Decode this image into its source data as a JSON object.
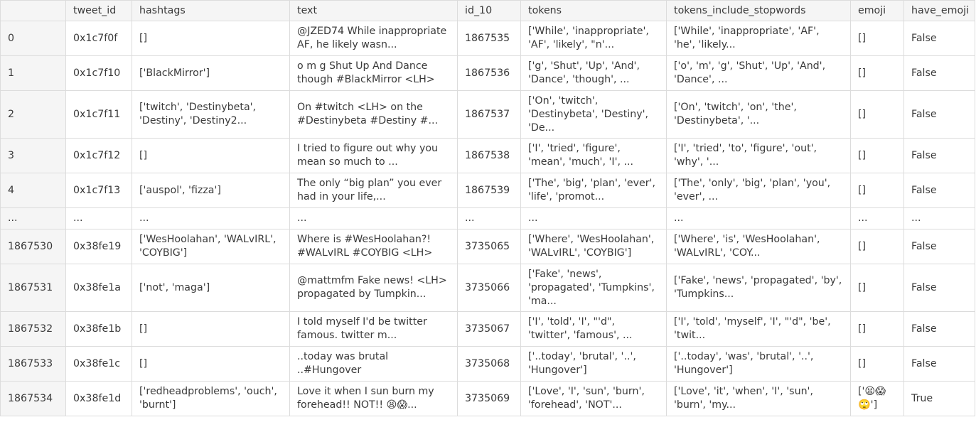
{
  "columns": [
    "",
    "tweet_id",
    "hashtags",
    "text",
    "id_10",
    "tokens",
    "tokens_include_stopwords",
    "emoji",
    "have_emoji"
  ],
  "rows": [
    {
      "index": "0",
      "tweet_id": "0x1c7f0f",
      "hashtags": "[]",
      "text": "@JZED74 While inappropriate AF, he likely wasn...",
      "id_10": "1867535",
      "tokens": "['While', 'inappropriate', 'AF', 'likely', \"n'...",
      "tokens_include_stopwords": "['While', 'inappropriate', 'AF', 'he', 'likely...",
      "emoji": "[]",
      "have_emoji": "False"
    },
    {
      "index": "1",
      "tweet_id": "0x1c7f10",
      "hashtags": "['BlackMirror']",
      "text": "o m g Shut Up And Dance though #BlackMirror <LH>",
      "id_10": "1867536",
      "tokens": "['g', 'Shut', 'Up', 'And', 'Dance', 'though', ...",
      "tokens_include_stopwords": "['o', 'm', 'g', 'Shut', 'Up', 'And', 'Dance', ...",
      "emoji": "[]",
      "have_emoji": "False"
    },
    {
      "index": "2",
      "tweet_id": "0x1c7f11",
      "hashtags": "['twitch', 'Destinybeta', 'Destiny', 'Destiny2...",
      "text": "On #twitch <LH> on the #Destinybeta #Destiny #...",
      "id_10": "1867537",
      "tokens": "['On', 'twitch', 'Destinybeta', 'Destiny', 'De...",
      "tokens_include_stopwords": "['On', 'twitch', 'on', 'the', 'Destinybeta', '...",
      "emoji": "[]",
      "have_emoji": "False"
    },
    {
      "index": "3",
      "tweet_id": "0x1c7f12",
      "hashtags": "[]",
      "text": "I tried to figure out why you mean so much to ...",
      "id_10": "1867538",
      "tokens": "['I', 'tried', 'figure', 'mean', 'much', 'I', ...",
      "tokens_include_stopwords": "['I', 'tried', 'to', 'figure', 'out', 'why', '...",
      "emoji": "[]",
      "have_emoji": "False"
    },
    {
      "index": "4",
      "tweet_id": "0x1c7f13",
      "hashtags": "['auspol', 'fizza']",
      "text": "The only “big plan” you ever had in your life,...",
      "id_10": "1867539",
      "tokens": "['The', 'big', 'plan', 'ever', 'life', 'promot...",
      "tokens_include_stopwords": "['The', 'only', 'big', 'plan', 'you', 'ever', ...",
      "emoji": "[]",
      "have_emoji": "False"
    },
    {
      "index": "...",
      "tweet_id": "...",
      "hashtags": "...",
      "text": "...",
      "id_10": "...",
      "tokens": "...",
      "tokens_include_stopwords": "...",
      "emoji": "...",
      "have_emoji": "..."
    },
    {
      "index": "1867530",
      "tweet_id": "0x38fe19",
      "hashtags": "['WesHoolahan', 'WALvIRL', 'COYBIG']",
      "text": "Where is #WesHoolahan?! #WALvIRL #COYBIG <LH>",
      "id_10": "3735065",
      "tokens": "['Where', 'WesHoolahan', 'WALvIRL', 'COYBIG']",
      "tokens_include_stopwords": "['Where', 'is', 'WesHoolahan', 'WALvIRL', 'COY...",
      "emoji": "[]",
      "have_emoji": "False"
    },
    {
      "index": "1867531",
      "tweet_id": "0x38fe1a",
      "hashtags": "['not', 'maga']",
      "text": "@mattmfm Fake news! <LH> propagated by Tumpkin...",
      "id_10": "3735066",
      "tokens": "['Fake', 'news', 'propagated', 'Tumpkins', 'ma...",
      "tokens_include_stopwords": "['Fake', 'news', 'propagated', 'by', 'Tumpkins...",
      "emoji": "[]",
      "have_emoji": "False"
    },
    {
      "index": "1867532",
      "tweet_id": "0x38fe1b",
      "hashtags": "[]",
      "text": "I told myself I'd be twitter famous. twitter m...",
      "id_10": "3735067",
      "tokens": "['I', 'told', 'I', \"'d\", 'twitter', 'famous', ...",
      "tokens_include_stopwords": "['I', 'told', 'myself', 'I', \"'d\", 'be', 'twit...",
      "emoji": "[]",
      "have_emoji": "False"
    },
    {
      "index": "1867533",
      "tweet_id": "0x38fe1c",
      "hashtags": "[]",
      "text": "..today was brutal ..#Hungover",
      "id_10": "3735068",
      "tokens": "['..today', 'brutal', '..', 'Hungover']",
      "tokens_include_stopwords": "['..today', 'was', 'brutal', '..', 'Hungover']",
      "emoji": "[]",
      "have_emoji": "False"
    },
    {
      "index": "1867534",
      "tweet_id": "0x38fe1d",
      "hashtags": "['redheadproblems', 'ouch', 'burnt']",
      "text": "Love it when I sun burn my forehead!! NOT!! 😫😱...",
      "id_10": "3735069",
      "tokens": "['Love', 'I', 'sun', 'burn', 'forehead', 'NOT'...",
      "tokens_include_stopwords": "['Love', 'it', 'when', 'I', 'sun', 'burn', 'my...",
      "emoji": "['😫😱🙄']",
      "have_emoji": "True"
    }
  ]
}
